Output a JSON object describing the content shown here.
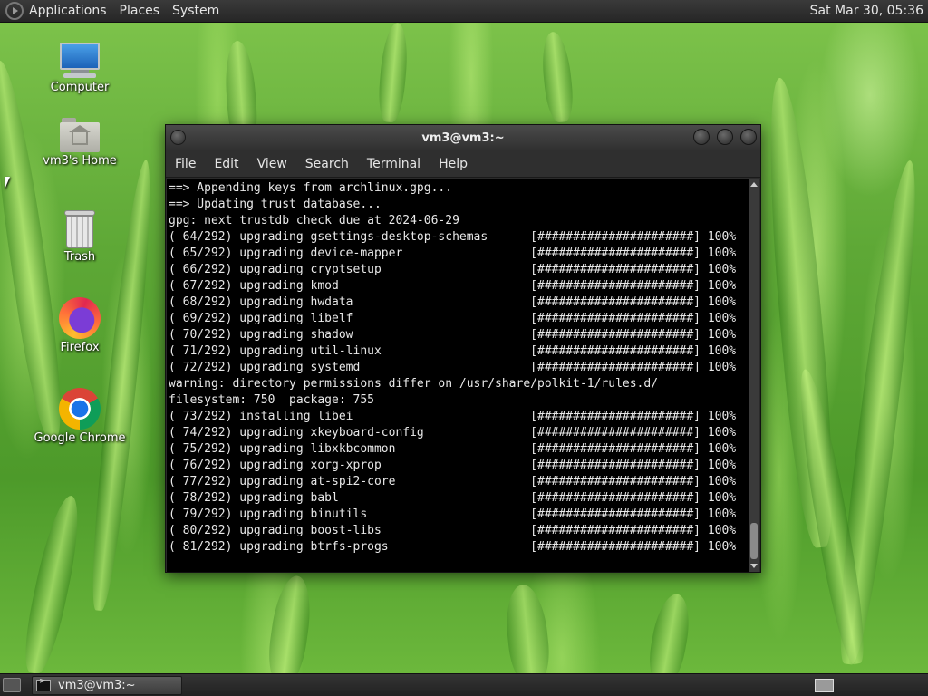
{
  "top_panel": {
    "menus": [
      "Applications",
      "Places",
      "System"
    ],
    "clock": "Sat Mar 30, 05:36"
  },
  "desktop_icons": [
    {
      "label": "Computer",
      "icon": "computer-icon"
    },
    {
      "label": "vm3's Home",
      "icon": "home-folder-icon"
    },
    {
      "label": "Trash",
      "icon": "trash-icon"
    },
    {
      "label": "Firefox",
      "icon": "firefox-icon"
    },
    {
      "label": "Google Chrome",
      "icon": "chrome-icon"
    }
  ],
  "window": {
    "title": "vm3@vm3:~",
    "menu": [
      "File",
      "Edit",
      "View",
      "Search",
      "Terminal",
      "Help"
    ]
  },
  "terminal": {
    "lines": [
      "==> Appending keys from archlinux.gpg...",
      "==> Updating trust database...",
      "gpg: next trustdb check due at 2024-06-29",
      "( 64/292) upgrading gsettings-desktop-schemas      [######################] 100%",
      "( 65/292) upgrading device-mapper                  [######################] 100%",
      "( 66/292) upgrading cryptsetup                     [######################] 100%",
      "( 67/292) upgrading kmod                           [######################] 100%",
      "( 68/292) upgrading hwdata                         [######################] 100%",
      "( 69/292) upgrading libelf                         [######################] 100%",
      "( 70/292) upgrading shadow                         [######################] 100%",
      "( 71/292) upgrading util-linux                     [######################] 100%",
      "( 72/292) upgrading systemd                        [######################] 100%",
      "warning: directory permissions differ on /usr/share/polkit-1/rules.d/",
      "filesystem: 750  package: 755",
      "( 73/292) installing libei                         [######################] 100%",
      "( 74/292) upgrading xkeyboard-config               [######################] 100%",
      "( 75/292) upgrading libxkbcommon                   [######################] 100%",
      "( 76/292) upgrading xorg-xprop                     [######################] 100%",
      "( 77/292) upgrading at-spi2-core                   [######################] 100%",
      "( 78/292) upgrading babl                           [######################] 100%",
      "( 79/292) upgrading binutils                       [######################] 100%",
      "( 80/292) upgrading boost-libs                     [######################] 100%",
      "( 81/292) upgrading btrfs-progs                    [######################] 100%"
    ]
  },
  "taskbar": {
    "tasks": [
      {
        "label": "vm3@vm3:~"
      }
    ]
  }
}
